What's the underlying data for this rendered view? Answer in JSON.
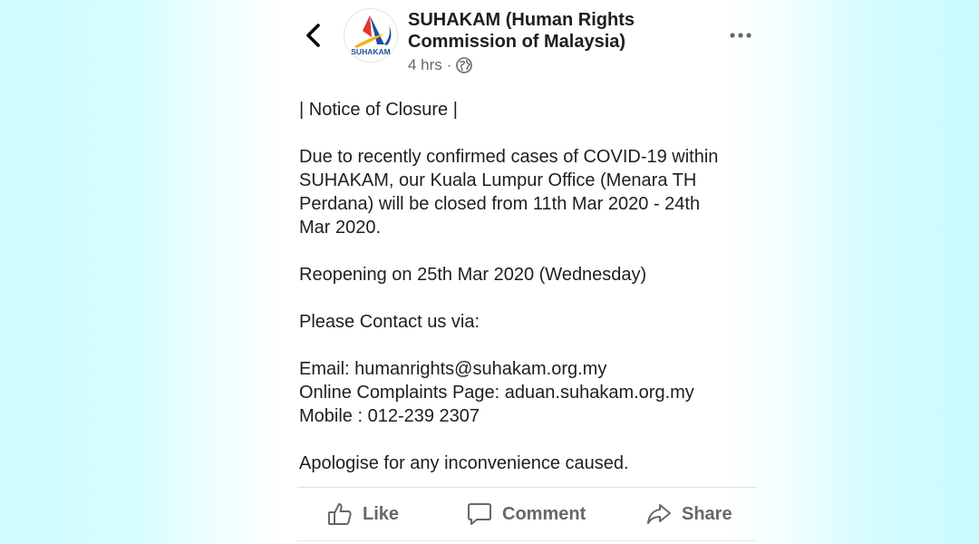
{
  "header": {
    "page_name_line1": "SUHAKAM (Human Rights",
    "page_name_line2": "Commission of Malaysia)",
    "time": "4 hrs",
    "separator": "·",
    "privacy_icon": "globe-icon",
    "back_icon": "chevron-left-icon",
    "more_icon": "more-horizontal-icon",
    "logo_text": "SUHAKAM"
  },
  "post": {
    "lines": [
      "| Notice of Closure |",
      "",
      "Due to recently confirmed cases of COVID-19 within",
      "SUHAKAM, our Kuala Lumpur Office (Menara TH",
      "Perdana) will be closed from 11th Mar 2020 - 24th",
      "Mar 2020.",
      "",
      "Reopening on 25th Mar 2020 (Wednesday)",
      "",
      "Please Contact us via:",
      "",
      "Email: humanrights@suhakam.org.my",
      "Online Complaints Page: aduan.suhakam.org.my",
      "Mobile : 012-239 2307",
      "",
      "Apologise for any inconvenience caused."
    ]
  },
  "actions": {
    "like": "Like",
    "comment": "Comment",
    "share": "Share",
    "like_icon": "thumbs-up-icon",
    "comment_icon": "comment-bubble-icon",
    "share_icon": "share-arrow-icon"
  },
  "colors": {
    "background_edge": "#c9fbff",
    "text": "#1c1e21",
    "secondary_text": "#65676b"
  }
}
